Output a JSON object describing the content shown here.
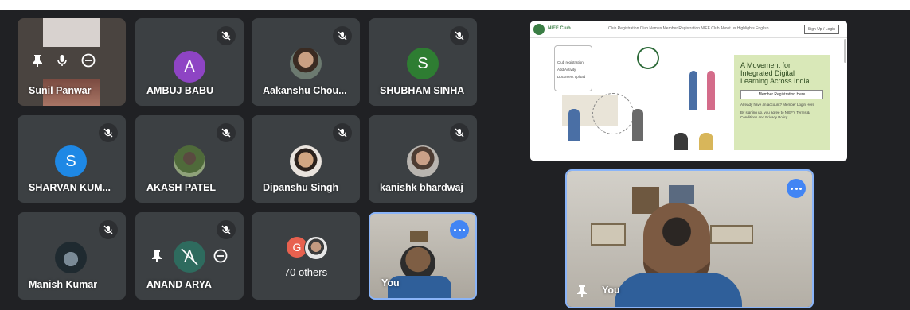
{
  "colors": {
    "background": "#202124",
    "tile": "#3c4043",
    "accent": "#4285f4",
    "selfview_border": "#8ab4f8"
  },
  "participants": [
    {
      "name": "Sunil Panwar",
      "type": "video-hovered",
      "muted": false
    },
    {
      "name": "AMBUJ BABU",
      "type": "letter",
      "letter": "A",
      "avatar_color": "#8e44c4",
      "muted": true
    },
    {
      "name": "Aakanshu Chou...",
      "type": "photo",
      "muted": true
    },
    {
      "name": "SHUBHAM SINHA",
      "type": "letter",
      "letter": "S",
      "avatar_color": "#2e7d32",
      "muted": true
    },
    {
      "name": "SHARVAN KUM...",
      "type": "letter",
      "letter": "S",
      "avatar_color": "#1e88e5",
      "muted": true
    },
    {
      "name": "AKASH PATEL",
      "type": "photo",
      "muted": true
    },
    {
      "name": "Dipanshu Singh",
      "type": "photo",
      "muted": true
    },
    {
      "name": "kanishk bhardwaj",
      "type": "photo",
      "muted": true
    },
    {
      "name": "Manish Kumar",
      "type": "photo",
      "muted": true
    },
    {
      "name": "ANAND ARYA",
      "type": "letter-hovered",
      "letter": "A",
      "avatar_color": "#2e6b5e",
      "muted": true
    }
  ],
  "others": {
    "label": "70 others",
    "letter": "G",
    "letter_color": "#e8614f"
  },
  "self_small": {
    "name": "You"
  },
  "self_large": {
    "name": "You"
  },
  "shared_screen": {
    "brand": "NIEF Club",
    "nav_links": "Club Registration   Club Names   Member Registration   NIEF Club   About us   Highlights   English",
    "signup": "Sign Up / Login",
    "headline": "A Movement for Integrated Digital Learning Across India",
    "cta": "Member Registration Here",
    "small1": "Already have an account? Member Login Here",
    "small2": "By signing up, you agree to NIEF's Terms & Conditions and Privacy Policy",
    "steps": [
      "Club registration",
      "Add Activity",
      "Document upload"
    ]
  }
}
